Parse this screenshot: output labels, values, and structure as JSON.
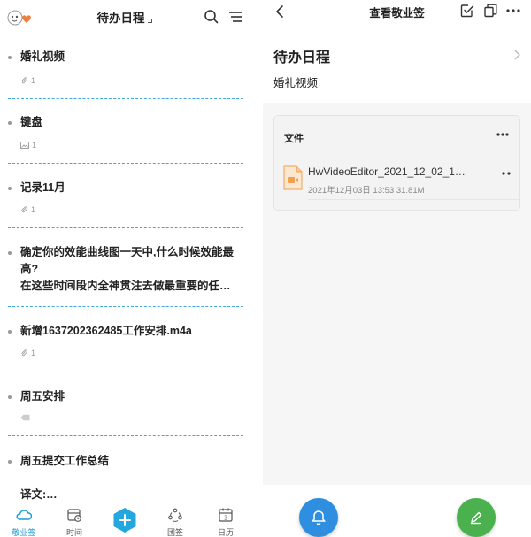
{
  "left": {
    "header": {
      "title": "待办日程"
    },
    "items": [
      {
        "title": "婚礼视频",
        "meta_icon": "paperclip-icon",
        "count": "1"
      },
      {
        "title": "键盘",
        "meta_icon": "image-icon",
        "count": "1"
      },
      {
        "title": "记录11月",
        "meta_icon": "paperclip-icon",
        "count": "1"
      },
      {
        "title": "确定你的效能曲线图一天中,什么时候效能最高?\n在这些时间段内全神贯注去做最重要的任…",
        "meta_icon": "",
        "count": ""
      },
      {
        "title": "新增1637202362485工作安排.m4a",
        "meta_icon": "paperclip-icon",
        "count": "1"
      },
      {
        "title": "周五安排",
        "meta_icon": "tag-icon",
        "count": ""
      },
      {
        "title": "周五提交工作总结\n\n译文:…",
        "meta_icon": "",
        "count": ""
      }
    ],
    "tabs": [
      {
        "label": "敬业签",
        "icon": "cloud-icon",
        "active": true
      },
      {
        "label": "时间",
        "icon": "calendar-clock-icon",
        "active": false
      },
      {
        "label": "团签",
        "icon": "team-icon",
        "active": false
      },
      {
        "label": "日历",
        "icon": "calendar-icon",
        "active": false,
        "badge": "3"
      }
    ],
    "colors": {
      "accent": "#1f9bd6",
      "divider": "#3fa7dc"
    }
  },
  "right": {
    "header": {
      "title": "查看敬业签"
    },
    "note": {
      "title": "待办日程",
      "subtitle": "婚礼视频"
    },
    "file_section": {
      "label": "文件",
      "file": {
        "name": "HwVideoEditor_2021_12_02_1…",
        "date": "2021年12月03日 13:53",
        "size": "31.81M"
      }
    },
    "colors": {
      "bell_fab": "#2e8fe0",
      "edit_fab": "#4bb14f",
      "file_icon": "#f0a050"
    }
  }
}
